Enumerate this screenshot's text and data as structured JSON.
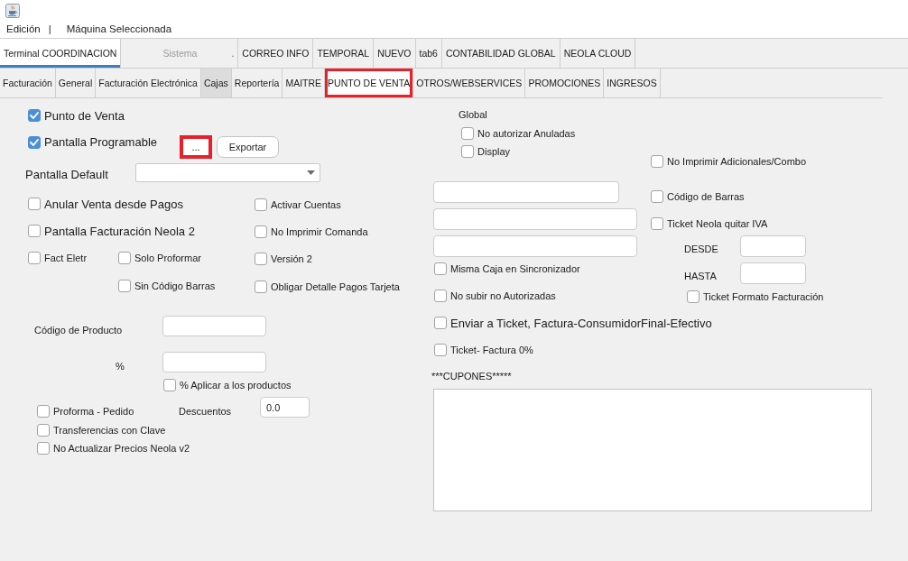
{
  "menu": [
    {
      "kind": "item",
      "label": "Edición"
    },
    {
      "kind": "separator",
      "label": "|"
    },
    {
      "kind": "item",
      "label": "Máquina Seleccionada"
    }
  ],
  "tabs": [
    {
      "label": "Terminal COORDINACION",
      "selected": true,
      "disabled": false
    },
    {
      "label": "Sistema",
      "note": ".",
      "selected": false,
      "disabled": true
    },
    {
      "label": "CORREO INFO",
      "selected": false,
      "disabled": false
    },
    {
      "label": "TEMPORAL",
      "selected": false,
      "disabled": false
    },
    {
      "label": "NUEVO",
      "selected": false,
      "disabled": false
    },
    {
      "label": "tab6",
      "selected": false,
      "disabled": false
    },
    {
      "label": "CONTABILIDAD GLOBAL",
      "selected": false,
      "disabled": false
    },
    {
      "label": "NEOLA CLOUD",
      "selected": false,
      "disabled": false
    }
  ],
  "subtabs": [
    {
      "label": "Facturación",
      "selected": false,
      "hovered": false,
      "highlighted": false
    },
    {
      "label": "General",
      "selected": false,
      "hovered": false,
      "highlighted": false
    },
    {
      "label": "Facturación Electrónica",
      "selected": false,
      "hovered": false,
      "highlighted": false
    },
    {
      "label": "Cajas",
      "selected": false,
      "hovered": true,
      "highlighted": false
    },
    {
      "label": "Reportería",
      "selected": false,
      "hovered": false,
      "highlighted": false
    },
    {
      "label": "MAITRE",
      "selected": false,
      "hovered": false,
      "highlighted": false
    },
    {
      "label": "PUNTO DE VENTA",
      "selected": true,
      "hovered": false,
      "highlighted": true
    },
    {
      "label": "OTROS/WEBSERVICES",
      "selected": false,
      "hovered": false,
      "highlighted": false
    },
    {
      "label": "PROMOCIONES",
      "selected": false,
      "hovered": false,
      "highlighted": false
    },
    {
      "label": "INGRESOS",
      "selected": false,
      "hovered": false,
      "highlighted": false
    }
  ],
  "punto_de_venta": {
    "main_options": [
      {
        "label": "Punto de Venta",
        "checked": true
      },
      {
        "label": "Pantalla Programable",
        "checked": true
      }
    ],
    "more_button": {
      "label": "...",
      "highlighted": true
    },
    "export_button": {
      "label": "Exportar"
    },
    "default_screen": {
      "label": "Pantalla Default"
    },
    "options": [
      {
        "label": "Anular Venta desde Pagos",
        "checked": false
      },
      {
        "label": "Activar Cuentas",
        "checked": false
      },
      {
        "label": "Pantalla Facturación Neola 2",
        "checked": false
      },
      {
        "label": "No Imprimir Comanda",
        "checked": false
      },
      {
        "label": "Fact Eletr",
        "checked": false
      },
      {
        "label": "Solo Proformar",
        "checked": false
      },
      {
        "label": "Versión 2",
        "checked": false
      },
      {
        "label": "Sin Código Barras",
        "checked": false
      },
      {
        "label": "Obligar Detalle Pagos Tarjeta",
        "checked": false
      }
    ],
    "product_code": {
      "label": "Código de Producto"
    },
    "percent": {
      "label": "%"
    },
    "apply_percent": {
      "label": "% Aplicar a los productos",
      "checked": false
    },
    "extra_options": [
      {
        "label": "Proforma - Pedido",
        "checked": false
      },
      {
        "label": "Transferencias con Clave",
        "checked": false
      },
      {
        "label": "No Actualizar Precios Neola v2",
        "checked": false
      }
    ],
    "discounts": {
      "label": "Descuentos",
      "value": "0.0"
    },
    "global": {
      "label": "Global",
      "options": [
        {
          "label": "No autorizar Anuladas",
          "checked": false
        },
        {
          "label": "Display",
          "checked": false
        }
      ]
    },
    "sync_options": [
      {
        "label": "Misma Caja en Sincronizador",
        "checked": false
      },
      {
        "label": "No subir no Autorizadas",
        "checked": false
      }
    ],
    "side_options": [
      {
        "label": "No Imprimir Adicionales/Combo",
        "checked": false
      },
      {
        "label": "Código de Barras",
        "checked": false
      },
      {
        "label": "Ticket Neola quitar IVA",
        "checked": false
      }
    ],
    "range": [
      {
        "label": "DESDE"
      },
      {
        "label": "HASTA"
      }
    ],
    "ticket_format": {
      "label": "Ticket Formato Facturación",
      "checked": false
    },
    "ticket_options": [
      {
        "label": "Enviar a Ticket, Factura-ConsumidorFinal-Efectivo",
        "checked": false
      },
      {
        "label": "Ticket- Factura 0%",
        "checked": false
      }
    ],
    "coupons": {
      "label": "***CUPONES*****"
    }
  }
}
